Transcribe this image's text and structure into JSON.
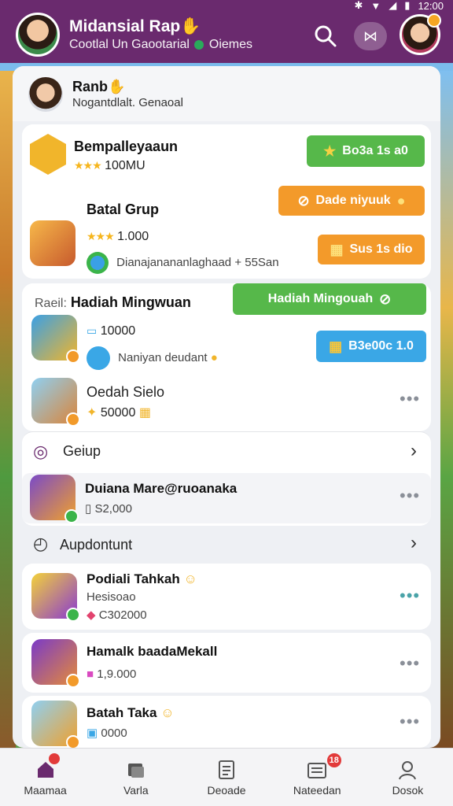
{
  "status": {
    "time": "12:00"
  },
  "header": {
    "title": "Midansial Rap",
    "subtitle_a": "Cootlal Un Gaootarial",
    "subtitle_b": "Oiemes"
  },
  "user": {
    "name": "Ranb",
    "subtitle": "Nogantdlalt. Genaoal"
  },
  "rank_card": {
    "title": "Bempalleyaaun",
    "stars_value": "100MU",
    "button1": "Bo3a 1s a0",
    "group_title": "Batal Grup",
    "group_value": "1.000",
    "group_desc": "Dianajanananlaghaad",
    "group_desc_suffix": "+ 55San",
    "button2": "Dade niyuuk",
    "button3": "Sus 1s dio"
  },
  "weekly": {
    "prefix": "Raeil:",
    "title": "Hadiah Mingwuan",
    "button": "Hadiah Mingouah",
    "item1_value": "10000",
    "item1_desc": "Naniyan deudant",
    "item1_button": "B3e00c 1.0",
    "item2_title": "Oedah Sielo",
    "item2_value": "50000"
  },
  "group_section": {
    "title": "Geiup",
    "item_title": "Duiana Mare@ruoanaka",
    "item_value": "S2,000"
  },
  "appointment_section": {
    "title": "Aupdontunt"
  },
  "list": [
    {
      "title": "Podiali Tahkah",
      "sub": "Hesisoao",
      "value": "C302000"
    },
    {
      "title": "Hamalk baadaMekall",
      "sub": "",
      "value": "1,9.000"
    },
    {
      "title": "Batah Taka",
      "sub": "",
      "value": "0000"
    }
  ],
  "nav": [
    {
      "label": "Maamaa",
      "icon": "home-icon",
      "badge": ""
    },
    {
      "label": "Varla",
      "icon": "cards-icon",
      "badge": ""
    },
    {
      "label": "Deoade",
      "icon": "document-icon",
      "badge": ""
    },
    {
      "label": "Nateedan",
      "icon": "inbox-icon",
      "badge": "18"
    },
    {
      "label": "Dosok",
      "icon": "profile-icon",
      "badge": ""
    }
  ]
}
